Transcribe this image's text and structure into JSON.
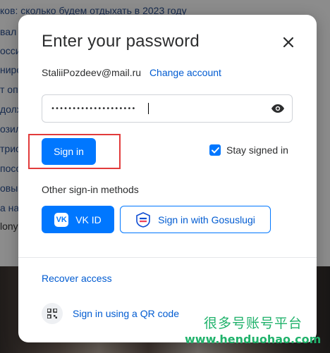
{
  "background": {
    "headline": "ков: сколько будем отдыхать в 2023 году",
    "fragments": [
      "вал",
      "осси",
      "ниро",
      "т опе",
      "долж",
      "озил",
      "трис",
      "посо",
      "овы",
      "а на",
      "lony"
    ]
  },
  "dialog": {
    "title": "Enter your password",
    "close_icon": "close-icon",
    "email": "StaliiPozdeev@mail.ru",
    "change_account": "Change account",
    "password_value": "••••••••••••••••••••",
    "eye_icon": "eye-icon",
    "sign_in": "Sign in",
    "stay_signed_in": "Stay signed in",
    "stay_signed_in_checked": true,
    "other_methods_label": "Other sign-in methods",
    "vk_logo": "VK",
    "vk_button": "VK ID",
    "gosuslugi_button": "Sign in with Gosuslugi",
    "recover_access": "Recover access",
    "qr_sign_in": "Sign in using a QR code"
  },
  "watermark": {
    "line1": "很多号账号平台",
    "line2": "www.henduohao.com"
  },
  "colors": {
    "accent": "#0077ff",
    "link": "#005bd1",
    "highlight": "#e23b3b",
    "watermark": "#20b26b"
  }
}
